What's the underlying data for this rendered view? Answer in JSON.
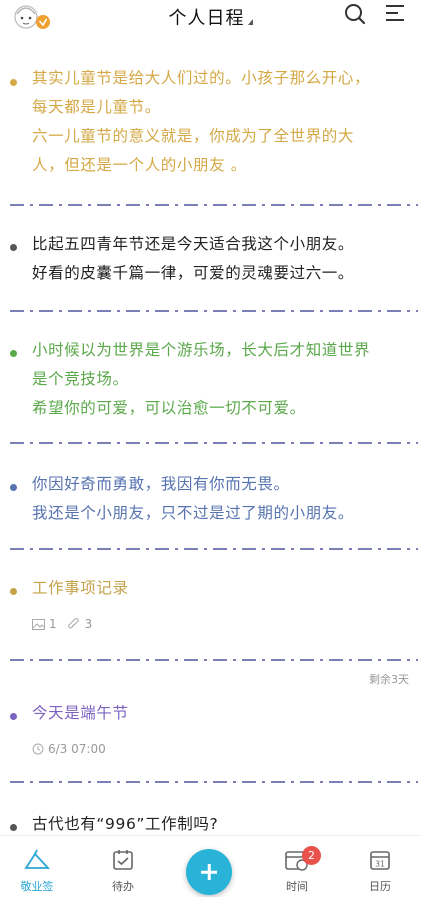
{
  "header": {
    "title": "个人日程"
  },
  "items": [
    {
      "color": "#d4a845",
      "lines": [
        "其实儿童节是给大人们过的。小孩子那么开心，",
        "每天都是儿童节。",
        "六一儿童节的意义就是，你成为了全世界的大",
        "人，但还是一个人的小朋友 。"
      ]
    },
    {
      "color": "#222222",
      "lines": [
        "比起五四青年节还是今天适合我这个小朋友。",
        "好看的皮囊千篇一律，可爱的灵魂要过六一。"
      ]
    },
    {
      "color": "#5aa84a",
      "lines": [
        "小时候以为世界是个游乐场，长大后才知道世界",
        "是个竞技场。",
        "希望你的可爱，可以治愈一切不可爱。"
      ]
    },
    {
      "color": "#5672b0",
      "lines": [
        "你因好奇而勇敢，我因有你而无畏。",
        "我还是个小朋友，只不过是过了期的小朋友。"
      ]
    },
    {
      "color": "#c4a24a",
      "lines": [
        "工作事项记录"
      ],
      "image_count": "1",
      "attachment_count": "3"
    },
    {
      "color": "#7b63c2",
      "lines": [
        "今天是端午节"
      ],
      "remaining": "剩余3天",
      "datetime": "6/3 07:00"
    },
    {
      "color": "#222222",
      "lines": [
        "古代也有“996”工作制吗?"
      ]
    }
  ],
  "nav": {
    "tabs": [
      "敬业签",
      "待办",
      "时间",
      "日历"
    ],
    "time_badge": "2",
    "calendar_day": "31",
    "accent": "#2ba6d6"
  }
}
